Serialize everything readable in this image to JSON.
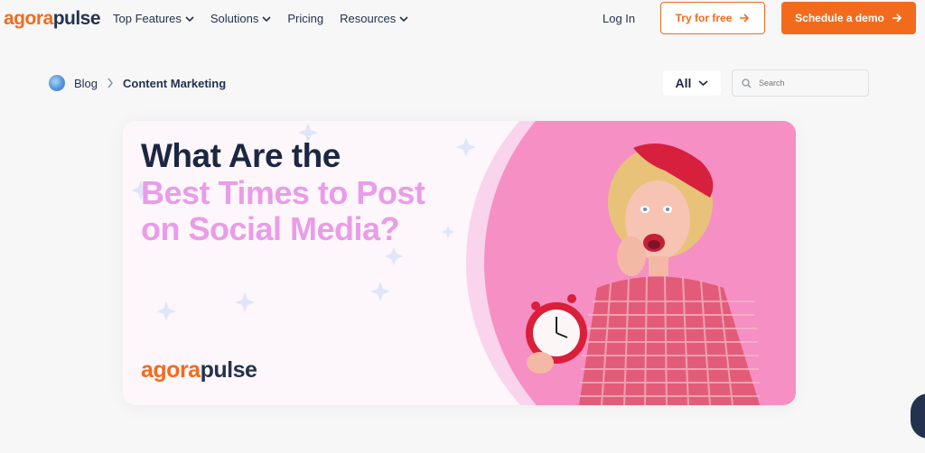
{
  "nav": {
    "logo_part1": "agora",
    "logo_part2": "pulse",
    "menu": [
      {
        "label": "Top Features"
      },
      {
        "label": "Solutions"
      },
      {
        "label": "Pricing"
      },
      {
        "label": "Resources"
      }
    ],
    "login_label": "Log In",
    "try_label": "Try for free",
    "demo_label": "Schedule a demo"
  },
  "breadcrumb": {
    "root": "Blog",
    "current": "Content Marketing"
  },
  "filter": {
    "selected": "All"
  },
  "search": {
    "placeholder": "Search"
  },
  "hero": {
    "title_dark": "What Are the",
    "title_pink": "Best Times to Post on Social Media?",
    "logo_part1": "agora",
    "logo_part2": "pulse"
  },
  "colors": {
    "brand_orange": "#f26b1d",
    "navy": "#24324f",
    "pink": "#e99ce8",
    "hero_pink": "#f58fc4"
  }
}
